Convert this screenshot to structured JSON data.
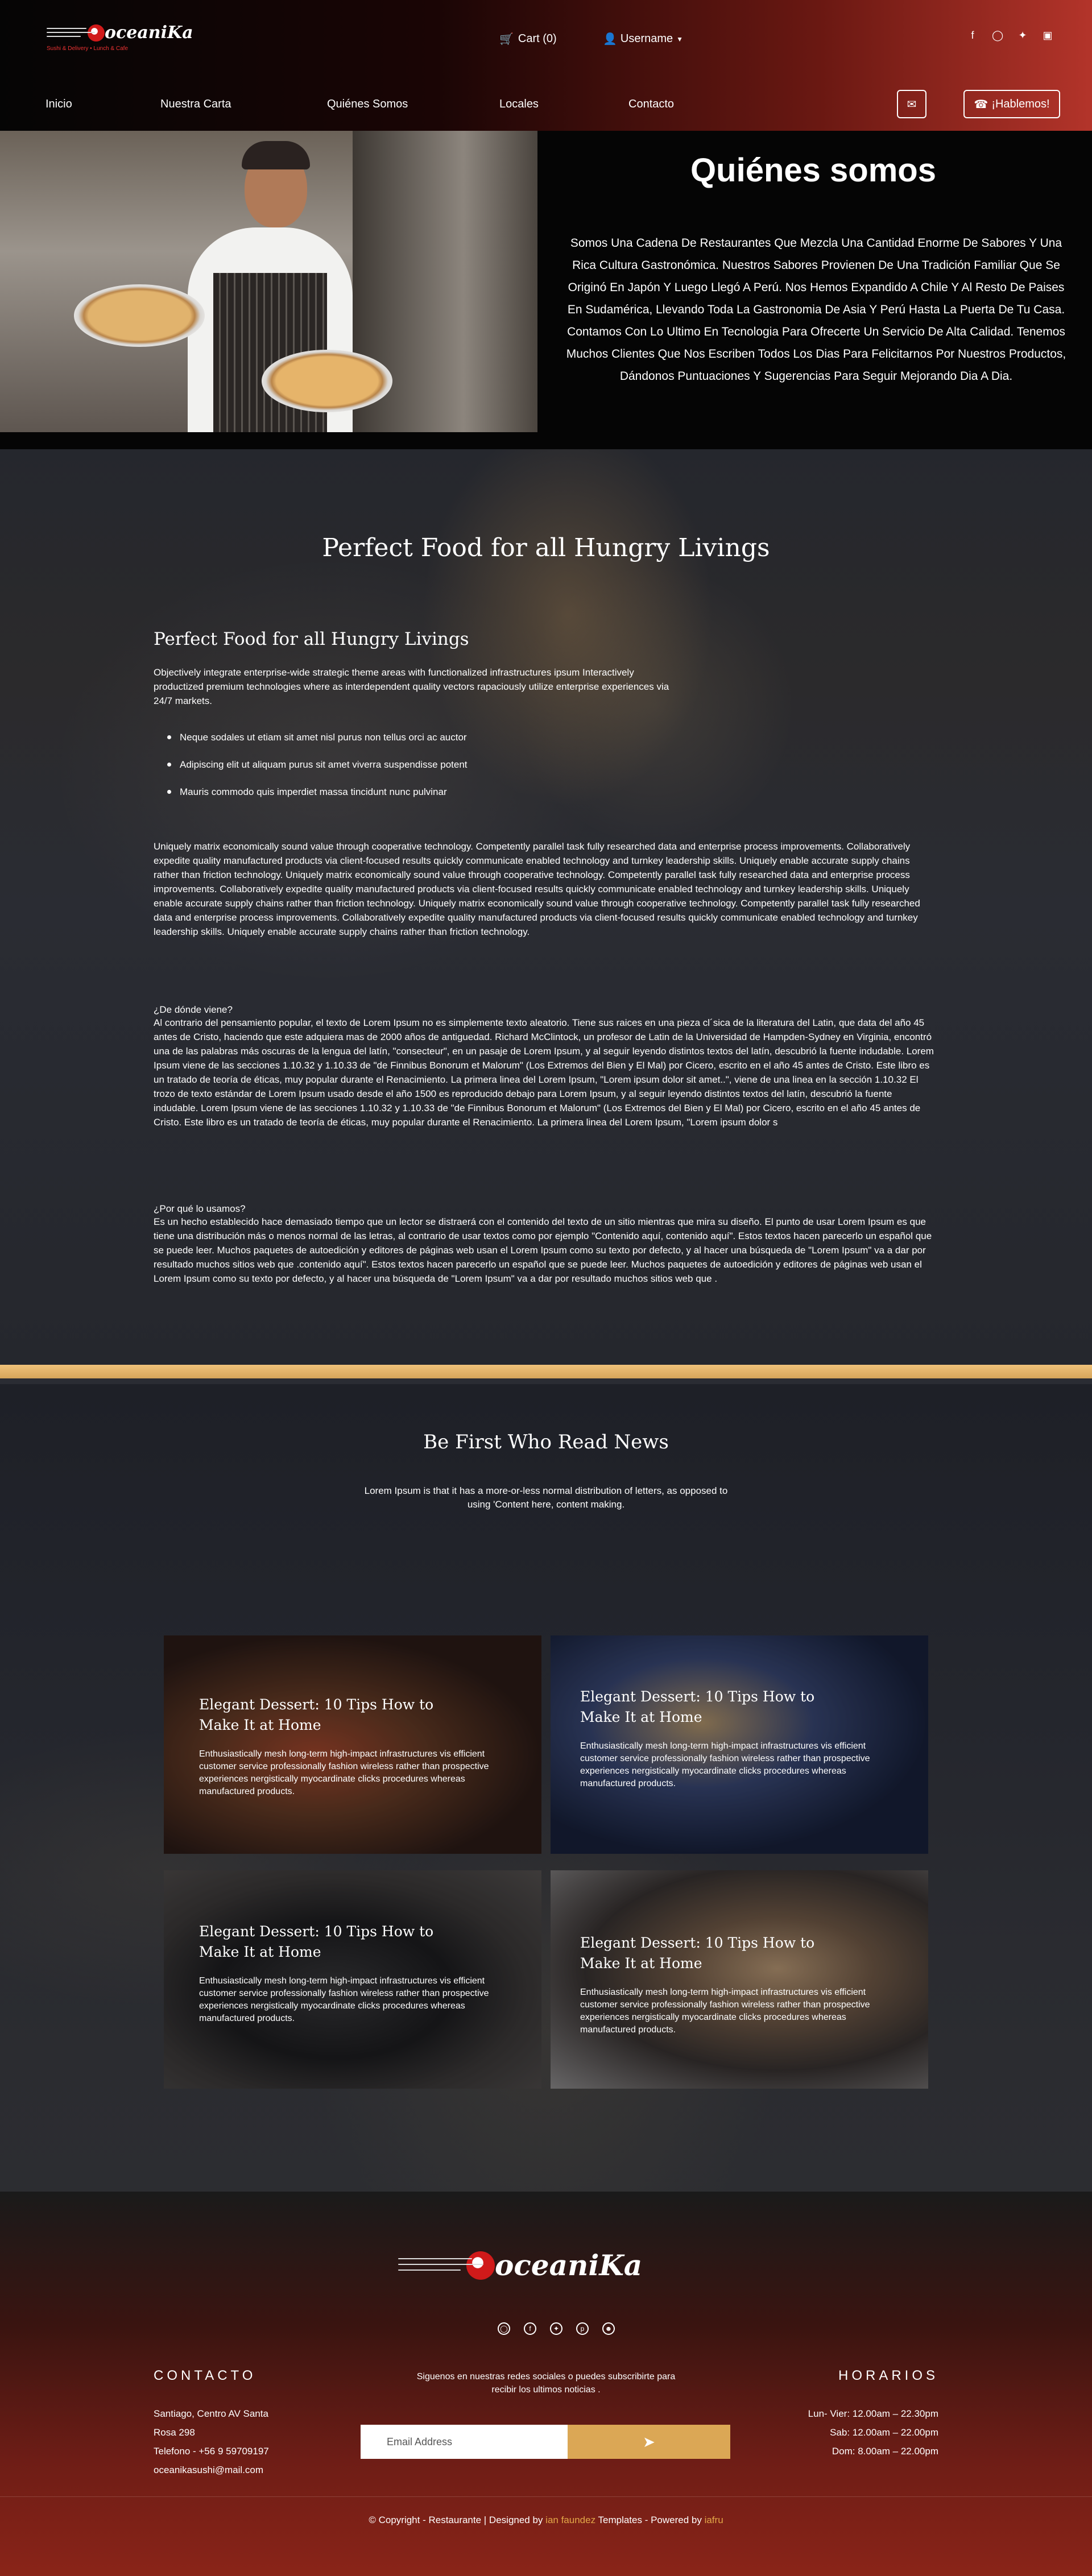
{
  "header": {
    "logo_text": "oceaniKa",
    "logo_tagline": "Sushi & Delivery • Lunch & Cafe",
    "cart_label": "Cart (0)",
    "user_label": "Username",
    "social_icons": [
      "facebook-icon",
      "instagram-icon",
      "twitter-icon",
      "linkedin-icon"
    ]
  },
  "nav": {
    "items": [
      "Inicio",
      "Nuestra Carta",
      "Quiénes Somos",
      "Locales",
      "Contacto"
    ],
    "hablemos_label": "¡Hablemos!"
  },
  "about": {
    "title": "Quiénes somos",
    "text": "Somos Una Cadena De Restaurantes Que Mezcla Una Cantidad Enorme De Sabores Y Una Rica Cultura Gastronómica. Nuestros Sabores Provienen De Una Tradición Familiar Que Se Originó En Japón Y Luego Llegó A Perú. Nos Hemos Expandido A Chile Y Al Resto De Paises En Sudamérica, Llevando Toda La Gastronomia De Asia Y Perú Hasta La Puerta De Tu Casa. Contamos Con Lo Ultimo En Tecnologia Para Ofrecerte Un Servicio De Alta Calidad. Tenemos Muchos Clientes Que Nos Escriben Todos Los Dias Para Felicitarnos Por Nuestros Productos, Dándonos Puntuaciones Y Sugerencias Para Seguir Mejorando Dia A Dia."
  },
  "story": {
    "h1": "Perfect Food for all Hungry Livings",
    "h2": "Perfect Food for all Hungry Livings",
    "p1": "Objectively integrate enterprise-wide strategic theme areas with functionalized infrastructures ipsum Interactively  productized premium technologies where as interdependent quality vectors rapaciously utilize enterprise experiences via 24/7 markets.",
    "list": [
      "Neque sodales ut etiam sit amet nisl purus non tellus orci ac auctor",
      "Adipiscing elit ut aliquam purus sit amet viverra suspendisse potent",
      "Mauris commodo quis imperdiet massa tincidunt nunc pulvinar"
    ],
    "p2": "Uniquely matrix economically sound value through cooperative technology. Competently parallel task fully researched data and enterprise process improvements. Collaboratively expedite quality manufactured products via client-focused results quickly communicate enabled technology and turnkey leadership skills. Uniquely enable accurate supply chains rather than friction technology. Uniquely matrix economically sound value through cooperative technology. Competently parallel task fully researched data and enterprise process improvements. Collaboratively expedite quality manufactured products via client-focused results quickly communicate enabled technology and turnkey leadership skills. Uniquely enable accurate supply chains rather than friction technology. Uniquely matrix economically sound value through cooperative technology. Competently parallel task fully researched data and enterprise process improvements. Collaboratively expedite quality manufactured products via client-focused results quickly communicate enabled technology and turnkey leadership skills. Uniquely enable accurate supply chains rather than friction technology.",
    "q1": "¿De dónde viene?",
    "p3": "Al contrario del pensamiento popular, el texto de Lorem Ipsum no es simplemente texto aleatorio. Tiene sus raices en una pieza cl´sica de la literatura del Latin, que data del año 45 antes de Cristo, haciendo que este adquiera mas de 2000 años de antiguedad. Richard McClintock, un profesor de Latin de la Universidad de Hampden-Sydney en Virginia, encontró una de las palabras más oscuras de la lengua del latín, \"consecteur\", en un pasaje de Lorem Ipsum, y al seguir leyendo distintos textos del latín, descubrió la fuente indudable. Lorem Ipsum viene de las secciones 1.10.32 y 1.10.33 de \"de Finnibus Bonorum et Malorum\" (Los Extremos del Bien y El Mal) por Cicero, escrito en el año 45 antes de Cristo. Este libro es un tratado de teoría de éticas, muy popular durante el Renacimiento. La primera linea del Lorem Ipsum, \"Lorem ipsum dolor sit amet..\", viene de una linea en la sección 1.10.32 El trozo de texto estándar de Lorem Ipsum usado desde el año 1500 es reproducido debajo para Lorem Ipsum, y al seguir leyendo distintos textos del latín, descubrió la fuente indudable. Lorem Ipsum viene de las secciones 1.10.32 y 1.10.33 de \"de Finnibus Bonorum et Malorum\" (Los Extremos del Bien y El Mal) por Cicero, escrito en el año 45 antes de Cristo. Este libro es un tratado de teoría de éticas, muy popular durante el Renacimiento. La primera linea del Lorem Ipsum, \"Lorem ipsum dolor s",
    "q2": "¿Por qué lo usamos?",
    "p4": "Es un hecho establecido hace demasiado tiempo que un lector se distraerá con el contenido del texto de un sitio mientras que mira su diseño. El punto de usar Lorem Ipsum es que tiene una distribución más o menos normal de las letras, al contrario de usar textos como por ejemplo \"Contenido aquí, contenido aquí\". Estos textos hacen parecerlo un español que se puede leer. Muchos paquetes de autoedición y editores de páginas web usan el Lorem Ipsum como su texto por defecto, y al hacer una búsqueda de \"Lorem Ipsum\" va a dar por resultado muchos sitios web que .contenido aquí\". Estos textos hacen parecerlo un español que se puede leer. Muchos paquetes de autoedición y editores de páginas web usan el Lorem Ipsum como su texto por defecto, y al hacer una búsqueda de \"Lorem Ipsum\" va a dar por resultado muchos sitios web que ."
  },
  "news": {
    "title": "Be First Who Read News",
    "subtitle": "Lorem Ipsum is that it has a more-or-less normal distribution of letters, as opposed to using 'Content here, content making.",
    "cards": [
      {
        "title": "Elegant Dessert: 10 Tips How to Make It at Home",
        "text": "Enthusiastically mesh long-term high-impact infrastructures vis efficient customer service professionally fashion wireless rather than prospective experiences nergistically myocardinate clicks procedures whereas manufactured products."
      },
      {
        "title": "Elegant Dessert: 10 Tips How to Make It at Home",
        "text": "Enthusiastically mesh long-term high-impact infrastructures vis efficient customer service professionally fashion wireless rather than prospective experiences nergistically myocardinate clicks procedures whereas manufactured products."
      },
      {
        "title": "Elegant Dessert: 10 Tips How to Make It at Home",
        "text": "Enthusiastically mesh long-term high-impact infrastructures vis efficient customer service professionally fashion wireless rather than prospective experiences nergistically myocardinate clicks procedures whereas manufactured products."
      },
      {
        "title": "Elegant Dessert: 10 Tips How to Make It at Home",
        "text": "Enthusiastically mesh long-term high-impact infrastructures vis efficient customer service professionally fashion wireless rather than prospective experiences nergistically myocardinate clicks procedures whereas manufactured products."
      }
    ]
  },
  "footer": {
    "logo_text": "oceaniKa",
    "contact_heading": "CONTACTO",
    "contact_lines": [
      "Santiago, Centro AV Santa",
      "Rosa 298",
      "Telefono - +56 9 59709197",
      "oceanikasushi@mail.com"
    ],
    "hours_heading": "HORARIOS",
    "hours_lines": [
      "Lun- Vier: 12.00am – 22.30pm",
      "Sab: 12.00am – 22.00pm",
      "Dom: 8.00am – 22.00pm"
    ],
    "subscribe_text": "Siguenos en nuestras redes sociales o puedes subscribirte para recibir los ultimos noticias .",
    "email_placeholder": "Email Address",
    "copy_prefix": "© Copyright - Restaurante | Designed by ",
    "copy_author": "ian faundez",
    "copy_middle": " Templates - Powered by ",
    "copy_powered": "iafru",
    "accent_color": "#dba755"
  }
}
